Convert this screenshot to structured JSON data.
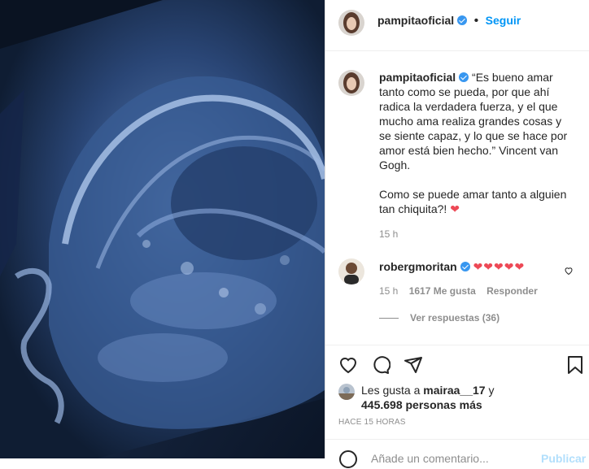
{
  "post": {
    "author": "pampitaoficial",
    "follow_label": "Seguir"
  },
  "caption": {
    "author": "pampitaoficial",
    "text": "“Es bueno amar tanto como se pueda, por que ahí radica la verdadera fuerza, y el que mucho ama realiza grandes cosas y se siente capaz, y lo que se hace por amor está bien hecho.” Vincent van Gogh.",
    "text2": "Como se puede amar tanto a alguien tan chiquita?!",
    "time": "15 h"
  },
  "comment": {
    "author": "robergmoritan",
    "hearts": "❤❤❤❤❤",
    "time": "15 h",
    "likes": "1617 Me gusta",
    "reply": "Responder",
    "view_replies": "Ver respuestas (36)"
  },
  "likes": {
    "prefix": "Les gusta a",
    "user": "mairaa__17",
    "conj": "y",
    "count": "445.698 personas más"
  },
  "timestamp": "HACE 15 HORAS",
  "add_comment": {
    "placeholder": "Añade un comentario...",
    "publish": "Publicar"
  },
  "colors": {
    "accent": "#0095f6",
    "heart": "#ed4956",
    "media_bg": "#0e1a2c"
  }
}
